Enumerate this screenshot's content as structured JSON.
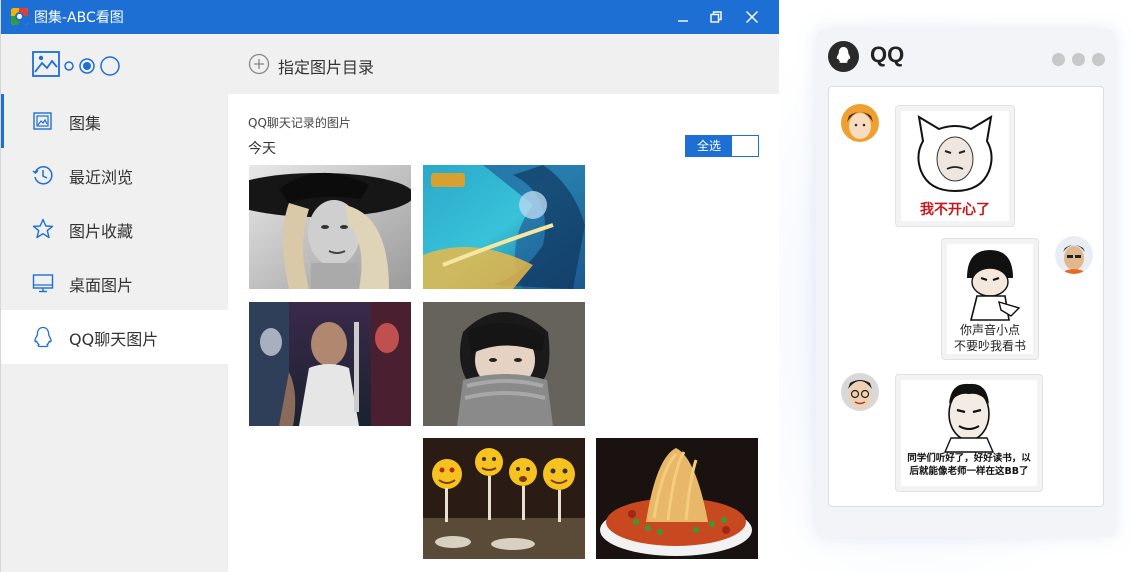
{
  "window": {
    "title": "图集-ABC看图",
    "controls": {
      "minimize": "minimize-icon",
      "restore": "restore-icon",
      "close": "close-icon"
    }
  },
  "sidebar": {
    "logo": "picture-slider-logo-icon",
    "items": [
      {
        "label": "图集",
        "icon": "album-icon"
      },
      {
        "label": "最近浏览",
        "icon": "history-clock-icon"
      },
      {
        "label": "图片收藏",
        "icon": "star-icon"
      },
      {
        "label": "桌面图片",
        "icon": "monitor-icon"
      },
      {
        "label": "QQ聊天图片",
        "icon": "qq-penguin-icon"
      }
    ],
    "selected_index": 4
  },
  "toolbar": {
    "add_dir_label": "指定图片目录"
  },
  "content": {
    "section_title": "QQ聊天记录的图片",
    "groups": [
      {
        "label": "今天",
        "select_all_label": "全选"
      }
    ],
    "thumbnails": [
      "woman-hat-bw-photo",
      "game-warrior-art",
      "movie-heroes-poster",
      "boy-scarf-photo",
      "emoji-party-photo",
      "noodle-bowl-photo"
    ]
  },
  "qq_panel": {
    "title": "QQ",
    "messages": [
      {
        "side": "left",
        "caption": "我不开心了"
      },
      {
        "side": "right",
        "caption_lines": [
          "你声音小点",
          "不要吵我看书"
        ]
      },
      {
        "side": "left",
        "caption_lines": [
          "同学们听好了，好好读书，以",
          "后就能像老师一样在这BB了"
        ]
      }
    ]
  },
  "colors": {
    "accent": "#1e6fd3",
    "sidebar_bg": "#f0f0f0",
    "meme_red": "#c8161d"
  }
}
